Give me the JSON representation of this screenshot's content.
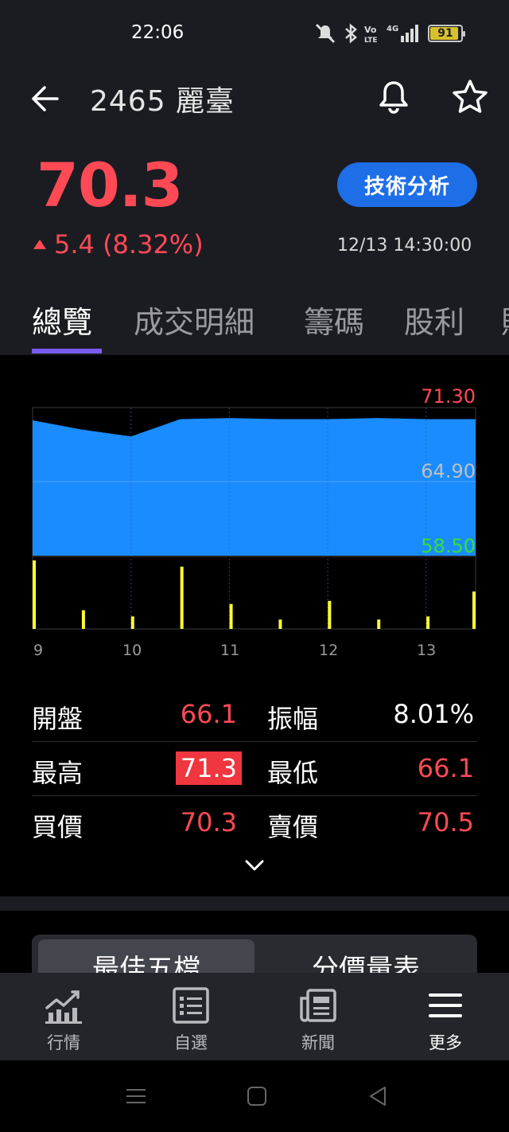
{
  "status": {
    "time": "22:06",
    "battery": "91",
    "battery_level": 0.91,
    "icons": [
      "mute-icon",
      "bluetooth-icon",
      "volte-icon",
      "4g-signal-icon",
      "battery-icon"
    ]
  },
  "header": {
    "title": "2465 麗臺",
    "price": "70.3",
    "change": "5.4 (8.32%)",
    "tech_button": "技術分析",
    "datetime": "12/13 14:30:00"
  },
  "tabs": [
    "總覽",
    "成交明細",
    "籌碼",
    "股利",
    "財"
  ],
  "chart": {
    "y_high": "71.30",
    "y_mid": "64.90",
    "y_low": "58.50",
    "x_labels": [
      "9",
      "10",
      "11",
      "12",
      "13"
    ],
    "colors": {
      "area": "#1a8cff",
      "volume": "#ffff33",
      "high": "#ff4a55",
      "mid": "#bfbfbf",
      "low": "#35e035"
    }
  },
  "chart_data": {
    "type": "area",
    "title": "",
    "xlabel": "",
    "ylabel": "",
    "ylim": [
      58.5,
      71.3
    ],
    "x": [
      "9",
      "9.5",
      "10",
      "10.5",
      "11",
      "11.5",
      "12",
      "12.5",
      "13",
      "13.5"
    ],
    "series": [
      {
        "values": [
          70.2,
          69.4,
          68.8,
          70.3,
          70.4,
          70.3,
          70.3,
          70.4,
          70.3,
          70.3
        ]
      }
    ],
    "volume": [
      220,
      60,
      40,
      200,
      80,
      30,
      90,
      30,
      40,
      120
    ]
  },
  "stats": {
    "rows": [
      {
        "l1": "開盤",
        "v1": "66.1",
        "l2": "振幅",
        "v2": "8.01%"
      },
      {
        "l1": "最高",
        "v1": "71.3",
        "l2": "最低",
        "v2": "66.1"
      },
      {
        "l1": "買價",
        "v1": "70.3",
        "l2": "賣價",
        "v2": "70.5"
      }
    ]
  },
  "segment": [
    "最佳五檔",
    "分價量表"
  ],
  "nav": [
    {
      "label": "行情",
      "icon": "chart-icon"
    },
    {
      "label": "自選",
      "icon": "list-icon"
    },
    {
      "label": "新聞",
      "icon": "news-icon"
    },
    {
      "label": "更多",
      "icon": "menu-icon"
    }
  ]
}
